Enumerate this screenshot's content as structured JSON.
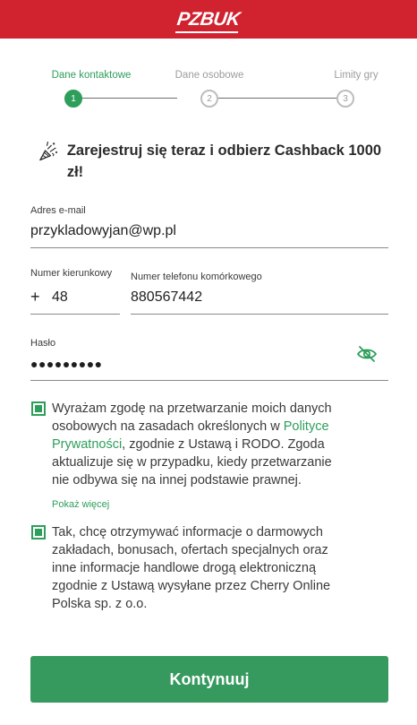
{
  "brand": {
    "logo_text": "PZBUK",
    "bar_color": "#d0222f"
  },
  "stepper": {
    "steps": [
      {
        "label": "Dane kontaktowe",
        "number": "1",
        "active": true
      },
      {
        "label": "Dane osobowe",
        "number": "2",
        "active": false
      },
      {
        "label": "Limity gry",
        "number": "3",
        "active": false
      }
    ]
  },
  "promo": {
    "icon": "party-popper-icon",
    "text": "Zarejestruj się teraz i odbierz Cashback 1000 zł!"
  },
  "form": {
    "email": {
      "label": "Adres e-mail",
      "value": "przykladowyjan@wp.pl"
    },
    "country_code": {
      "label": "Numer kierunkowy",
      "prefix": "+",
      "value": "48"
    },
    "phone": {
      "label": "Numer telefonu komórkowego",
      "value": "880567442"
    },
    "password": {
      "label": "Hasło",
      "value": "●●●●●●●●●",
      "toggle_icon": "eye-off-icon"
    }
  },
  "consents": {
    "privacy": {
      "checked": true,
      "text_before": "Wyrażam zgodę na przetwarzanie moich danych osobowych na zasadach określonych w ",
      "link_text": "Polityce Prywatności",
      "text_after": ", zgodnie z Ustawą i RODO. Zgoda aktualizuje się w przypadku, kiedy przetwarzanie nie odbywa się na innej podstawie prawnej.",
      "show_more": "Pokaż więcej"
    },
    "marketing": {
      "checked": true,
      "text": "Tak, chcę otrzymywać informacje o darmowych zakładach, bonusach, ofertach specjalnych oraz inne informacje handlowe drogą elektroniczną zgodnie z Ustawą wysyłane przez Cherry Online Polska sp. z o.o."
    }
  },
  "submit": {
    "label": "Kontynuuj",
    "color": "#369a5e"
  },
  "accent_color": "#2e9e5b"
}
